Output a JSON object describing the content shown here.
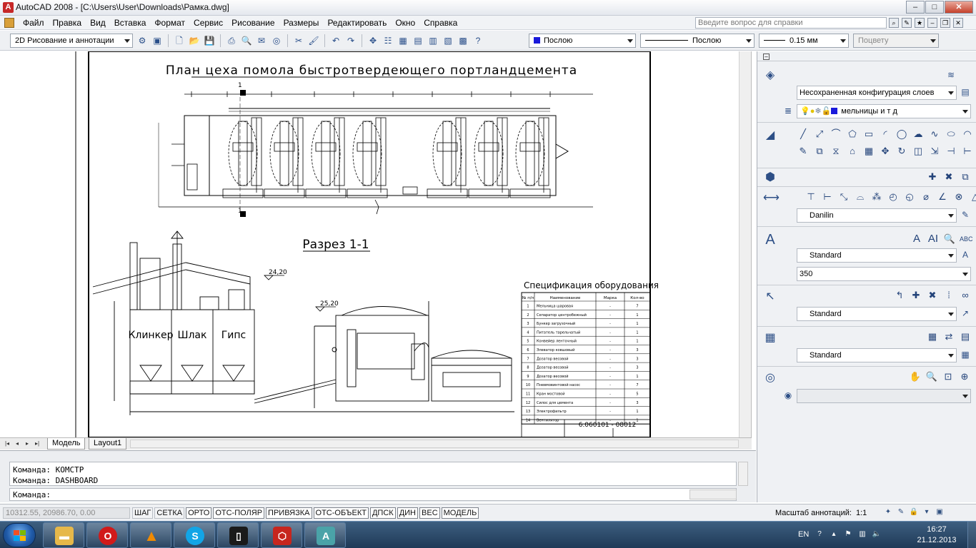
{
  "window": {
    "title": "AutoCAD 2008 - [C:\\Users\\User\\Downloads\\Рамка.dwg]",
    "minimize": "–",
    "maximize": "□",
    "close": "✕"
  },
  "menu": {
    "items": [
      "Файл",
      "Правка",
      "Вид",
      "Вставка",
      "Формат",
      "Сервис",
      "Рисование",
      "Размеры",
      "Редактировать",
      "Окно",
      "Справка"
    ],
    "help_placeholder": "Введите вопрос для справки"
  },
  "toolbar": {
    "workspace": "2D Рисование и аннотации",
    "color": "Послою",
    "linetype": "Послою",
    "lineweight": "0.15 мм",
    "plotstyle": "Поцвету"
  },
  "drawing": {
    "plan_title": "План цеха помола быстротвердеющего портландцемента",
    "section_title": "Разрез 1-1",
    "spec_title": "Спецификация оборудования",
    "silo_labels": [
      "Клинкер",
      "Шлак",
      "Гипс"
    ],
    "elevation_1": "24,20",
    "elevation_2": "25,20",
    "section_mark": "1",
    "spec_headers": [
      "№ п/п",
      "Наименование",
      "Марка",
      "Кол-во"
    ],
    "spec_rows": [
      [
        "1",
        "Мельница шаровая",
        "-",
        "7"
      ],
      [
        "2",
        "Сепаратор центробежный",
        "-",
        "1"
      ],
      [
        "3",
        "Бункер загрузочный",
        "-",
        "1"
      ],
      [
        "4",
        "Питатель тарельчатый",
        "-",
        "1"
      ],
      [
        "5",
        "Конвейер ленточный",
        "-",
        "1"
      ],
      [
        "6",
        "Элеватор ковшовый",
        "-",
        "3"
      ],
      [
        "7",
        "Дозатор весовой",
        "-",
        "3"
      ],
      [
        "8",
        "Дозатор весовой",
        "-",
        "3"
      ],
      [
        "9",
        "Дозатор весовой",
        "-",
        "1"
      ],
      [
        "10",
        "Пневмовинтовой насос",
        "-",
        "7"
      ],
      [
        "11",
        "Кран мостовой",
        "-",
        "5"
      ],
      [
        "12",
        "Силос для цемента",
        "-",
        "3"
      ],
      [
        "13",
        "Электрофильтр",
        "-",
        "1"
      ],
      [
        "14",
        "Вентилятор",
        "-",
        "1"
      ]
    ],
    "stamp_code": "6.060101 - 08012"
  },
  "tabs": {
    "model": "Модель",
    "layout1": "Layout1"
  },
  "command": {
    "history": [
      "Команда: КОМСТР",
      "Команда: DASHBOARD"
    ],
    "prompt": "Команда:"
  },
  "dashboard": {
    "layer_config": "Несохраненная конфигурация слоев",
    "current_layer": "мельницы и т д",
    "dim_style": "Danilin",
    "text_style": "Standard",
    "text_height": "350",
    "multileader_style": "Standard",
    "table_style": "Standard",
    "plot_style": "Standard"
  },
  "status": {
    "coords": "10312.55, 20986.70, 0.00",
    "toggles": [
      "ШАГ",
      "СЕТКА",
      "ОРТО",
      "ОТС-ПОЛЯР",
      "ПРИВЯЗКА",
      "ОТС-ОБЪЕКТ",
      "ДПСК",
      "ДИН",
      "ВЕС",
      "МОДЕЛЬ"
    ],
    "annotation_label": "Масштаб аннотаций:",
    "annotation_scale": "1:1"
  },
  "taskbar": {
    "lang": "EN",
    "time": "16:27",
    "date": "21.12.2013"
  },
  "colors": {
    "accent": "#1a1adb",
    "taskbar": "#2b4a6b"
  }
}
